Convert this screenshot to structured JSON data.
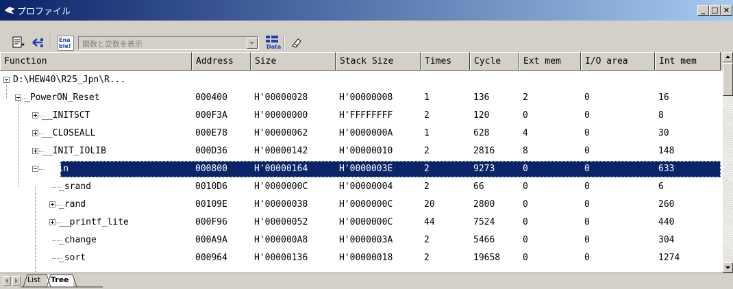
{
  "window": {
    "title": "プロファイル",
    "controls": [
      "_",
      "□",
      "×"
    ]
  },
  "toolbar": {
    "combo_placeholder": "関数と変数を表示",
    "icons": [
      "doc-icon",
      "tree-link-icon",
      "enable-icon",
      "data-icon",
      "eraser-icon"
    ],
    "enable_label": "Ena ble!",
    "data_label": "Data"
  },
  "columns": [
    "Function",
    "Address",
    "Size",
    "Stack Size",
    "Times",
    "Cycle",
    "Ext mem",
    "I/O area",
    "Int mem"
  ],
  "rows": [
    {
      "function": "D:\\HEW40\\R25_Jpn\\R...",
      "address": "",
      "size": "",
      "stack": "",
      "times": "",
      "cycle": "",
      "ext": "",
      "io": "",
      "int": "",
      "level": 0,
      "expander": "minus"
    },
    {
      "function": "_PowerON_Reset",
      "address": "000400",
      "size": "H'00000028",
      "stack": "H'00000008",
      "times": "1",
      "cycle": "136",
      "ext": "2",
      "io": "0",
      "int": "16",
      "level": 1,
      "expander": "minus"
    },
    {
      "function": "__INITSCT",
      "address": "000F3A",
      "size": "H'00000000",
      "stack": "H'FFFFFFFF",
      "times": "2",
      "cycle": "120",
      "ext": "0",
      "io": "0",
      "int": "8",
      "level": 2,
      "expander": "plus"
    },
    {
      "function": "__CLOSEALL",
      "address": "000E78",
      "size": "H'00000062",
      "stack": "H'0000000A",
      "times": "1",
      "cycle": "628",
      "ext": "4",
      "io": "0",
      "int": "30",
      "level": 2,
      "expander": "plus"
    },
    {
      "function": "__INIT_IOLIB",
      "address": "000D36",
      "size": "H'00000142",
      "stack": "H'00000010",
      "times": "2",
      "cycle": "2816",
      "ext": "8",
      "io": "0",
      "int": "148",
      "level": 2,
      "expander": "plus"
    },
    {
      "function": "_main",
      "address": "000800",
      "size": "H'00000164",
      "stack": "H'0000003E",
      "times": "2",
      "cycle": "9273",
      "ext": "0",
      "io": "0",
      "int": "633",
      "level": 2,
      "expander": "minus",
      "selected": true
    },
    {
      "function": "_srand",
      "address": "0010D6",
      "size": "H'0000000C",
      "stack": "H'00000004",
      "times": "2",
      "cycle": "66",
      "ext": "0",
      "io": "0",
      "int": "6",
      "level": 3,
      "expander": "none"
    },
    {
      "function": "_rand",
      "address": "00109E",
      "size": "H'00000038",
      "stack": "H'0000000C",
      "times": "20",
      "cycle": "2800",
      "ext": "0",
      "io": "0",
      "int": "260",
      "level": 3,
      "expander": "plus"
    },
    {
      "function": "__printf_lite",
      "address": "000F96",
      "size": "H'00000052",
      "stack": "H'0000000C",
      "times": "44",
      "cycle": "7524",
      "ext": "0",
      "io": "0",
      "int": "440",
      "level": 3,
      "expander": "plus"
    },
    {
      "function": "_change",
      "address": "000A9A",
      "size": "H'000000A8",
      "stack": "H'0000003A",
      "times": "2",
      "cycle": "5466",
      "ext": "0",
      "io": "0",
      "int": "304",
      "level": 3,
      "expander": "none"
    },
    {
      "function": "_sort",
      "address": "000964",
      "size": "H'00000136",
      "stack": "H'00000018",
      "times": "2",
      "cycle": "19658",
      "ext": "0",
      "io": "0",
      "int": "1274",
      "level": 3,
      "expander": "none"
    }
  ],
  "tabs": [
    "List",
    "Tree"
  ],
  "active_tab": "Tree",
  "colors": {
    "selection": "#0a246a",
    "title_start": "#0a246a",
    "title_end": "#a6caf0"
  }
}
